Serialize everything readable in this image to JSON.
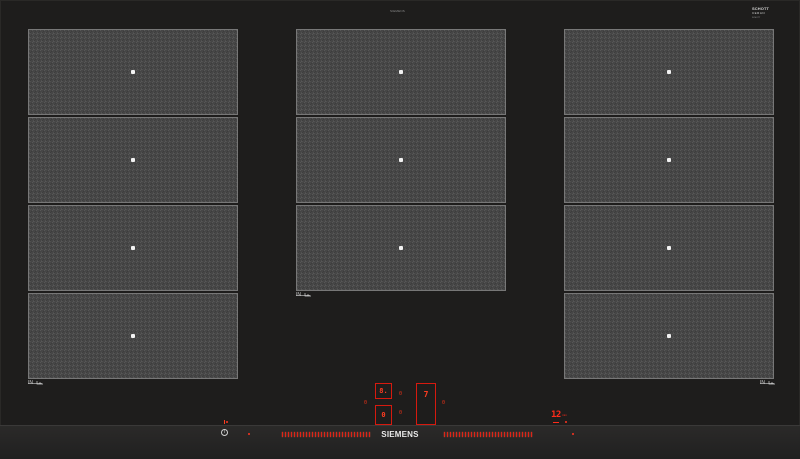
{
  "top_mark": "SIEMENS",
  "logo": {
    "main": "SCHOTT",
    "sub": "CERAN",
    "code": "SCHOTT"
  },
  "zones": {
    "left_label": "IN",
    "mid_label": "IN",
    "right_label": "IN"
  },
  "displays": {
    "main": "8.",
    "minor": "0",
    "side": "7",
    "mini_a": "0",
    "mini_b": "0",
    "mini_c": "0",
    "mini_d": "0",
    "timer": "12",
    "timer_unit": "min"
  },
  "brand": "SIEMENS",
  "power_symbol": "i"
}
